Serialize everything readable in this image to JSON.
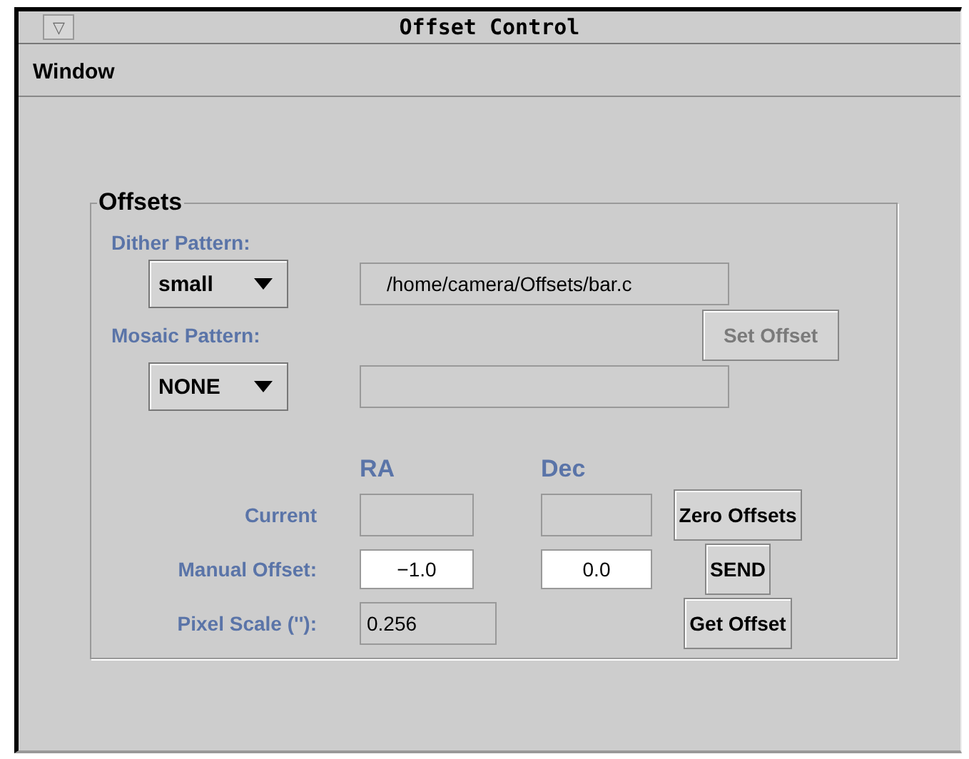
{
  "window": {
    "title": "Offset Control",
    "menu_button": "▽"
  },
  "menu": [
    {
      "label": "Window"
    }
  ],
  "offsets": {
    "title": "Offsets",
    "patterns": [
      {
        "label": "Dither Pattern:",
        "choice": "small",
        "path": "/home/camera/Offsets/bar.c"
      },
      {
        "label": "Mosaic Pattern:",
        "choice": "NONE"
      }
    ],
    "set_offset": {
      "label": "Set Offset",
      "disabled": true
    },
    "columns": [
      "RA",
      "Dec"
    ],
    "rows": [
      {
        "label": "Current",
        "fields": [
          {
            "editable": false
          },
          {
            "editable": false
          }
        ],
        "button": "Zero Offsets"
      },
      {
        "label": "Manual Offset:",
        "fields": [
          {
            "value": "−1.0",
            "editable": true
          },
          {
            "value": "0.0",
            "editable": true
          }
        ],
        "button": "SEND"
      },
      {
        "label": "Pixel Scale (''):",
        "fields": [
          {
            "value": "0.256",
            "editable": false
          }
        ],
        "button": "Get Offset"
      }
    ]
  }
}
